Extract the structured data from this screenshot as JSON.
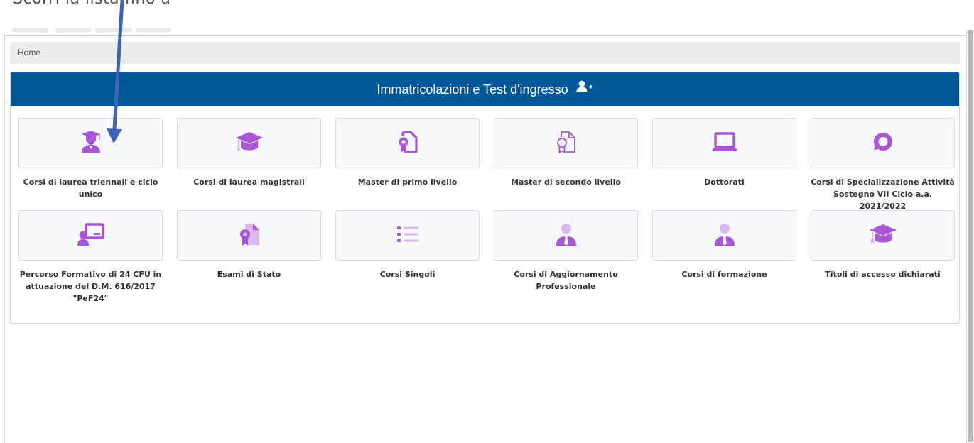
{
  "top_banner": {
    "partial_text": "Scorri la lista fino a trovare il corso"
  },
  "breadcrumb": {
    "home_label": "Home"
  },
  "panel": {
    "title": "Immatricolazioni e Test d'ingresso",
    "title_icon": "user-plus-icon"
  },
  "accent_colors": {
    "header_blue": "#00579a",
    "icon_purple": "#a855d6",
    "icon_light_purple": "#dcb8f0",
    "arrow_blue": "#3f63b8"
  },
  "cards": [
    {
      "label": "Corsi di laurea triennali e ciclo unico",
      "icon": "graduate-student-icon"
    },
    {
      "label": "Corsi di laurea magistrali",
      "icon": "graduation-cap-icon"
    },
    {
      "label": "Master di primo livello",
      "icon": "certificate-document-icon"
    },
    {
      "label": "Master di secondo livello",
      "icon": "certificate-document-outline-icon"
    },
    {
      "label": "Dottorati",
      "icon": "laptop-icon"
    },
    {
      "label": "Corsi di Specializzazione Attività Sostegno VII Ciclo a.a. 2021/2022",
      "icon": "chat-bubble-icon"
    },
    {
      "label": "Percorso Formativo di 24 CFU in attuazione del D.M. 616/2017 \"PeF24\"",
      "icon": "teacher-board-icon"
    },
    {
      "label": "Esami di Stato",
      "icon": "certificate-document-icon"
    },
    {
      "label": "Corsi Singoli",
      "icon": "list-icon"
    },
    {
      "label": "Corsi di Aggiornamento Professionale",
      "icon": "professional-person-icon"
    },
    {
      "label": "Corsi di formazione",
      "icon": "professional-person-icon"
    },
    {
      "label": "Titoli di accesso dichiarati",
      "icon": "graduation-cap-icon"
    }
  ]
}
